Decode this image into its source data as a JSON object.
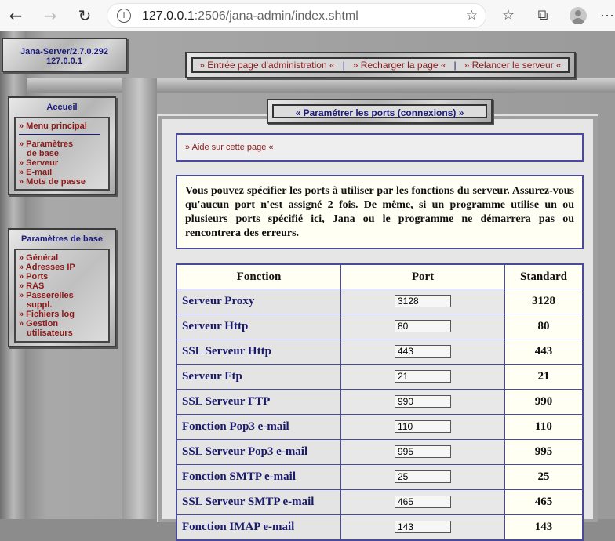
{
  "browser": {
    "url_host": "127.0.0.1",
    "url_rest": ":2506/jana-admin/index.shtml"
  },
  "server": {
    "name": "Jana-Server/2.7.0.292",
    "ip": "127.0.0.1"
  },
  "topnav": [
    "» Entrée page d'administration «",
    "» Recharger la page «",
    "» Relancer le serveur «"
  ],
  "sidebar_home": {
    "title": "Accueil",
    "menu_principal": "» Menu principal",
    "items": [
      "» Paramètres",
      "de base",
      "» Serveur",
      "» E-mail",
      "» Mots de passe"
    ]
  },
  "sidebar_params": {
    "title": "Paramètres de base",
    "items": [
      "» Général",
      "» Adresses IP",
      "» Ports",
      "» RAS",
      "» Passerelles",
      "suppl.",
      "» Fichiers log",
      "» Gestion",
      "utilisateurs"
    ]
  },
  "main": {
    "title": "« Paramétrer les ports (connexions) »",
    "help": "» Aide sur cette page «",
    "intro": "Vous pouvez spécifier les ports à utiliser par les fonctions du serveur. Assurez-vous qu'aucun port n'est assigné 2 fois. De même, si un programme utilise un ou plusieurs ports spécifié ici, Jana ou le programme ne démarrera pas ou rencontrera des erreurs."
  },
  "table": {
    "headers": [
      "Fonction",
      "Port",
      "Standard"
    ],
    "rows": [
      {
        "fn": "Serveur Proxy",
        "port": "3128",
        "std": "3128"
      },
      {
        "fn": "Serveur Http",
        "port": "80",
        "std": "80"
      },
      {
        "fn": "SSL Serveur Http",
        "port": "443",
        "std": "443"
      },
      {
        "fn": "Serveur Ftp",
        "port": "21",
        "std": "21"
      },
      {
        "fn": "SSL Serveur FTP",
        "port": "990",
        "std": "990"
      },
      {
        "fn": "Fonction Pop3 e-mail",
        "port": "110",
        "std": "110"
      },
      {
        "fn": "SSL Serveur Pop3 e-mail",
        "port": "995",
        "std": "995"
      },
      {
        "fn": "Fonction SMTP e-mail",
        "port": "25",
        "std": "25"
      },
      {
        "fn": "SSL Serveur SMTP e-mail",
        "port": "465",
        "std": "465"
      },
      {
        "fn": "Fonction IMAP e-mail",
        "port": "143",
        "std": "143"
      }
    ]
  }
}
